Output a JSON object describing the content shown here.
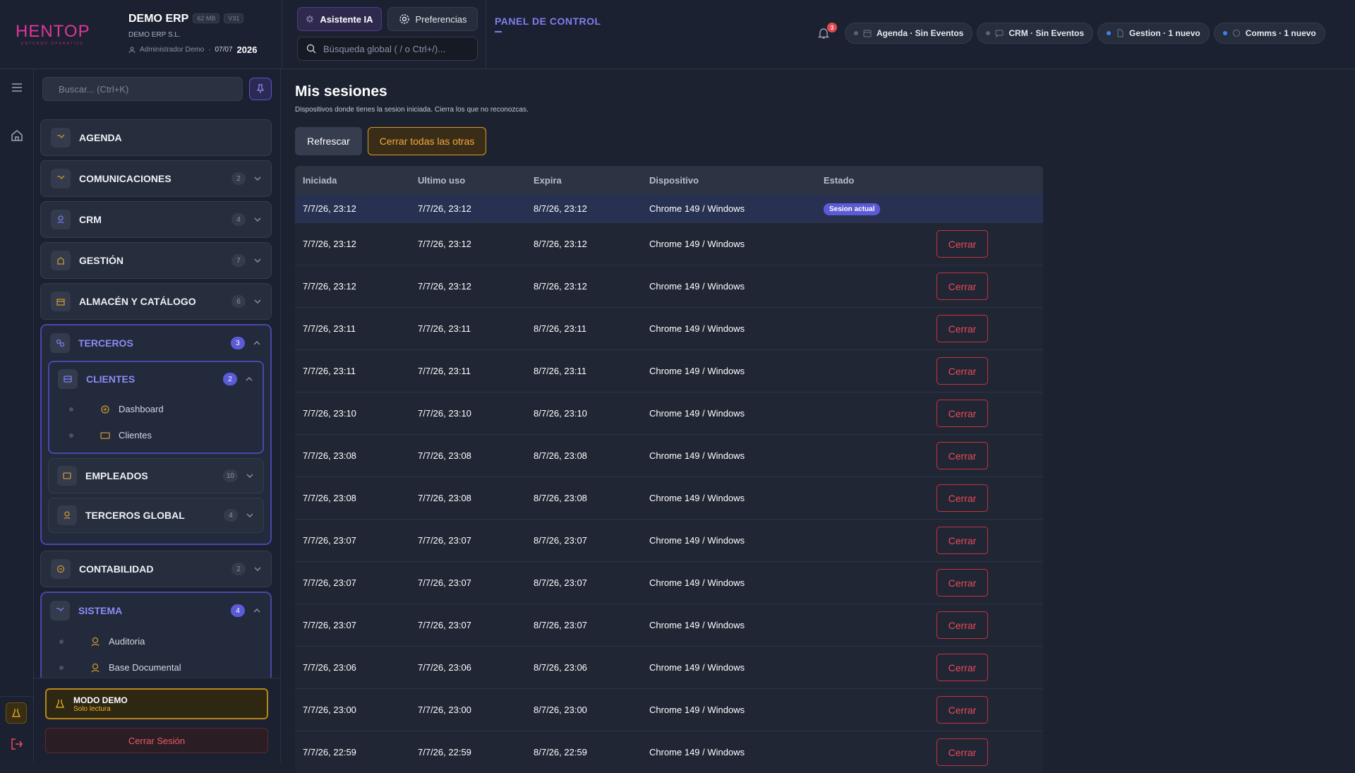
{
  "header": {
    "logo_text": "HENTOP",
    "logo_subtext": "ENTORNO OPERATIVO",
    "app_name": "DEMO ERP",
    "size_tag": "62 MB",
    "version_tag": "V31",
    "company": "DEMO ERP S.L.",
    "user": "Administrador Demo",
    "date_short": "07/07",
    "year": "2026",
    "ai_button": "Asistente IA",
    "prefs_button": "Preferencias",
    "search_placeholder": "Búsqueda global ( / o Ctrl+/)...",
    "panel_title": "PANEL DE CONTROL",
    "notifications_count": "3",
    "chips": [
      {
        "label": "Agenda · Sin Eventos",
        "dot": "gray"
      },
      {
        "label": "CRM · Sin Eventos",
        "dot": "gray"
      },
      {
        "label": "Gestion · 1 nuevo",
        "dot": "blue"
      },
      {
        "label": "Comms · 1 nuevo",
        "dot": "blue"
      }
    ]
  },
  "sidebar": {
    "search_placeholder": "Buscar... (Ctrl+K)",
    "items": [
      {
        "label": "AGENDA",
        "count": ""
      },
      {
        "label": "COMUNICACIONES",
        "count": "2"
      },
      {
        "label": "CRM",
        "count": "4"
      },
      {
        "label": "GESTIÓN",
        "count": "7"
      },
      {
        "label": "ALMACÉN Y CATÁLOGO",
        "count": "6"
      }
    ],
    "terceros": {
      "label": "TERCEROS",
      "count": "3",
      "clientes": {
        "label": "CLIENTES",
        "count": "2",
        "subs": [
          "Dashboard",
          "Clientes"
        ]
      },
      "empleados": {
        "label": "EMPLEADOS",
        "count": "10"
      },
      "global": {
        "label": "TERCEROS GLOBAL",
        "count": "4"
      }
    },
    "contabilidad": {
      "label": "CONTABILIDAD",
      "count": "2"
    },
    "sistema": {
      "label": "SISTEMA",
      "count": "4",
      "subs": [
        "Auditoria",
        "Base Documental"
      ]
    },
    "demo_title": "MODO DEMO",
    "demo_sub": "Solo lectura",
    "logout": "Cerrar Sesión"
  },
  "main": {
    "title": "Mis sesiones",
    "subtitle": "Dispositivos donde tienes la sesion iniciada. Cierra los que no reconozcas.",
    "refresh": "Refrescar",
    "close_all": "Cerrar todas las otras",
    "columns": [
      "Iniciada",
      "Ultimo uso",
      "Expira",
      "Dispositivo",
      "Estado"
    ],
    "current_badge": "Sesion actual",
    "close_label": "Cerrar",
    "rows": [
      {
        "start": "7/7/26, 23:12",
        "last": "7/7/26, 23:12",
        "exp": "8/7/26, 23:12",
        "device": "Chrome 149 / Windows"
      },
      {
        "start": "7/7/26, 23:12",
        "last": "7/7/26, 23:12",
        "exp": "8/7/26, 23:12",
        "device": "Chrome 149 / Windows"
      },
      {
        "start": "7/7/26, 23:12",
        "last": "7/7/26, 23:12",
        "exp": "8/7/26, 23:12",
        "device": "Chrome 149 / Windows"
      },
      {
        "start": "7/7/26, 23:11",
        "last": "7/7/26, 23:11",
        "exp": "8/7/26, 23:11",
        "device": "Chrome 149 / Windows"
      },
      {
        "start": "7/7/26, 23:11",
        "last": "7/7/26, 23:11",
        "exp": "8/7/26, 23:11",
        "device": "Chrome 149 / Windows"
      },
      {
        "start": "7/7/26, 23:10",
        "last": "7/7/26, 23:10",
        "exp": "8/7/26, 23:10",
        "device": "Chrome 149 / Windows"
      },
      {
        "start": "7/7/26, 23:08",
        "last": "7/7/26, 23:08",
        "exp": "8/7/26, 23:08",
        "device": "Chrome 149 / Windows"
      },
      {
        "start": "7/7/26, 23:08",
        "last": "7/7/26, 23:08",
        "exp": "8/7/26, 23:08",
        "device": "Chrome 149 / Windows"
      },
      {
        "start": "7/7/26, 23:07",
        "last": "7/7/26, 23:07",
        "exp": "8/7/26, 23:07",
        "device": "Chrome 149 / Windows"
      },
      {
        "start": "7/7/26, 23:07",
        "last": "7/7/26, 23:07",
        "exp": "8/7/26, 23:07",
        "device": "Chrome 149 / Windows"
      },
      {
        "start": "7/7/26, 23:07",
        "last": "7/7/26, 23:07",
        "exp": "8/7/26, 23:07",
        "device": "Chrome 149 / Windows"
      },
      {
        "start": "7/7/26, 23:06",
        "last": "7/7/26, 23:06",
        "exp": "8/7/26, 23:06",
        "device": "Chrome 149 / Windows"
      },
      {
        "start": "7/7/26, 23:00",
        "last": "7/7/26, 23:00",
        "exp": "8/7/26, 23:00",
        "device": "Chrome 149 / Windows"
      },
      {
        "start": "7/7/26, 22:59",
        "last": "7/7/26, 22:59",
        "exp": "8/7/26, 22:59",
        "device": "Chrome 149 / Windows"
      }
    ]
  },
  "colors": {
    "accent": "#5b5bd6",
    "danger": "#ef4a57",
    "warning": "#d99a26",
    "logo": "#e0359b"
  }
}
